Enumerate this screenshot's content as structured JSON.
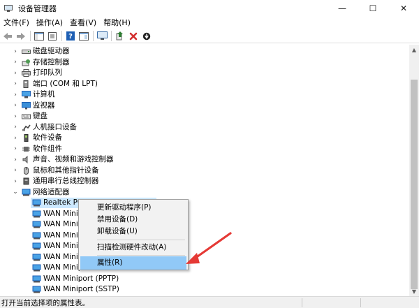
{
  "window": {
    "title": "设备管理器",
    "minimize": "—",
    "maximize": "☐",
    "close": "✕"
  },
  "menu": [
    "文件(F)",
    "操作(A)",
    "查看(V)",
    "帮助(H)"
  ],
  "toolbar": {
    "buttons": [
      "back-icon",
      "forward-icon",
      "properties-panel-icon",
      "list-view-icon",
      "help-icon",
      "console-icon",
      "monitor-scan-icon",
      "update-driver-icon",
      "uninstall-icon",
      "disable-device-icon"
    ],
    "colors": {
      "update": "#2e7d32",
      "uninstall": "#d32f2f"
    }
  },
  "tree": {
    "categories": [
      {
        "label": "磁盘驱动器",
        "icon": "disk-drive-icon"
      },
      {
        "label": "存储控制器",
        "icon": "storage-controller-icon"
      },
      {
        "label": "打印队列",
        "icon": "printer-icon"
      },
      {
        "label": "端口 (COM 和 LPT)",
        "icon": "port-icon"
      },
      {
        "label": "计算机",
        "icon": "computer-icon"
      },
      {
        "label": "监视器",
        "icon": "monitor-icon"
      },
      {
        "label": "键盘",
        "icon": "keyboard-icon"
      },
      {
        "label": "人机接口设备",
        "icon": "hid-icon"
      },
      {
        "label": "软件设备",
        "icon": "software-device-icon"
      },
      {
        "label": "软件组件",
        "icon": "software-component-icon"
      },
      {
        "label": "声音、视频和游戏控制器",
        "icon": "sound-icon"
      },
      {
        "label": "鼠标和其他指针设备",
        "icon": "mouse-icon"
      },
      {
        "label": "通用串行总线控制器",
        "icon": "usb-icon"
      }
    ],
    "expanded": {
      "label": "网络适配器",
      "icon": "network-adapter-icon"
    },
    "children": [
      "Realtek PCI",
      "WAN Minip",
      "WAN Minip",
      "WAN Minip",
      "WAN Minip",
      "WAN Minip",
      "WAN Minip",
      "WAN Miniport (PPTP)",
      "WAN Miniport (SSTP)"
    ]
  },
  "context_menu": {
    "items": [
      "更新驱动程序(P)",
      "禁用设备(D)",
      "卸载设备(U)",
      "扫描检测硬件改动(A)",
      "属性(R)"
    ],
    "highlighted": "属性(R)"
  },
  "annotation": {
    "color": "#e53935"
  },
  "status": {
    "text": "打开当前选择项的属性表。"
  }
}
